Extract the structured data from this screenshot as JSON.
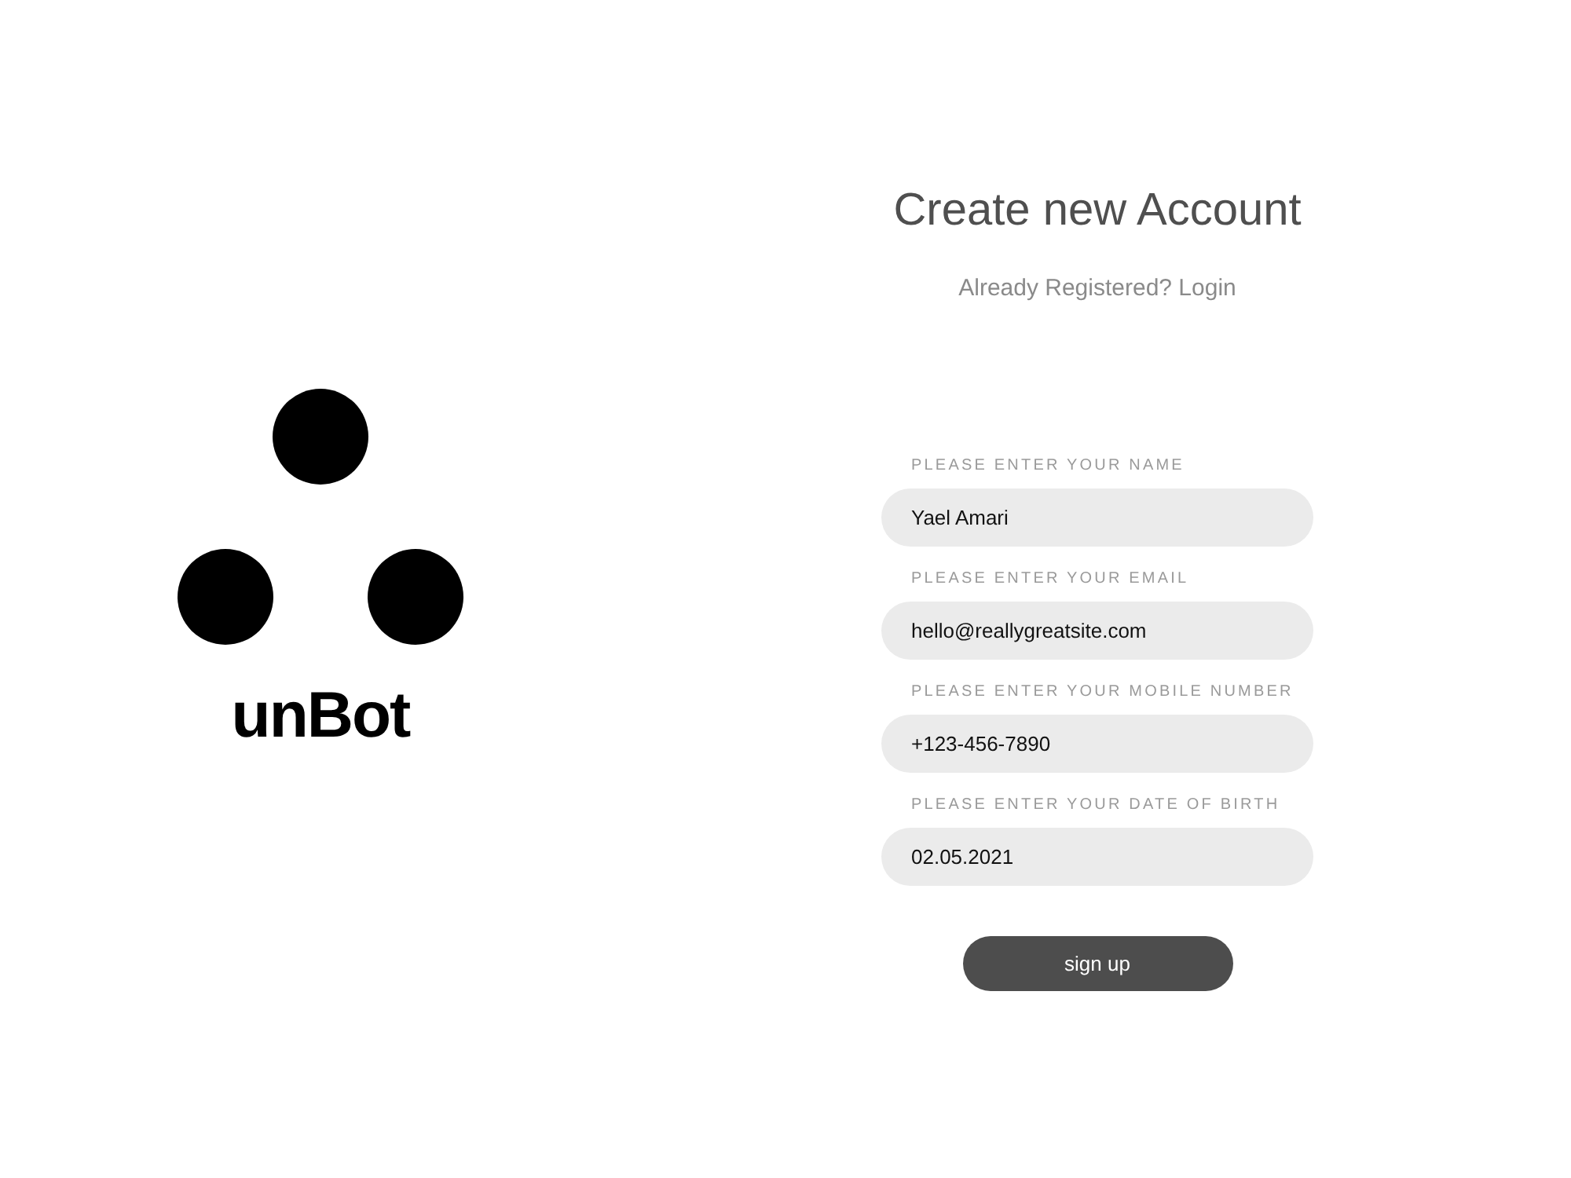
{
  "logo": {
    "wordmark": "unBot"
  },
  "form": {
    "title": "Create new Account",
    "login_prompt": "Already Registered? Login",
    "fields": [
      {
        "label": "PLEASE ENTER YOUR NAME",
        "value": "Yael Amari"
      },
      {
        "label": "PLEASE ENTER YOUR EMAIL",
        "value": "hello@reallygreatsite.com"
      },
      {
        "label": "PLEASE ENTER YOUR MOBILE NUMBER",
        "value": "+123-456-7890"
      },
      {
        "label": "PLEASE ENTER YOUR DATE OF BIRTH",
        "value": "02.05.2021"
      }
    ],
    "submit": "sign up"
  }
}
